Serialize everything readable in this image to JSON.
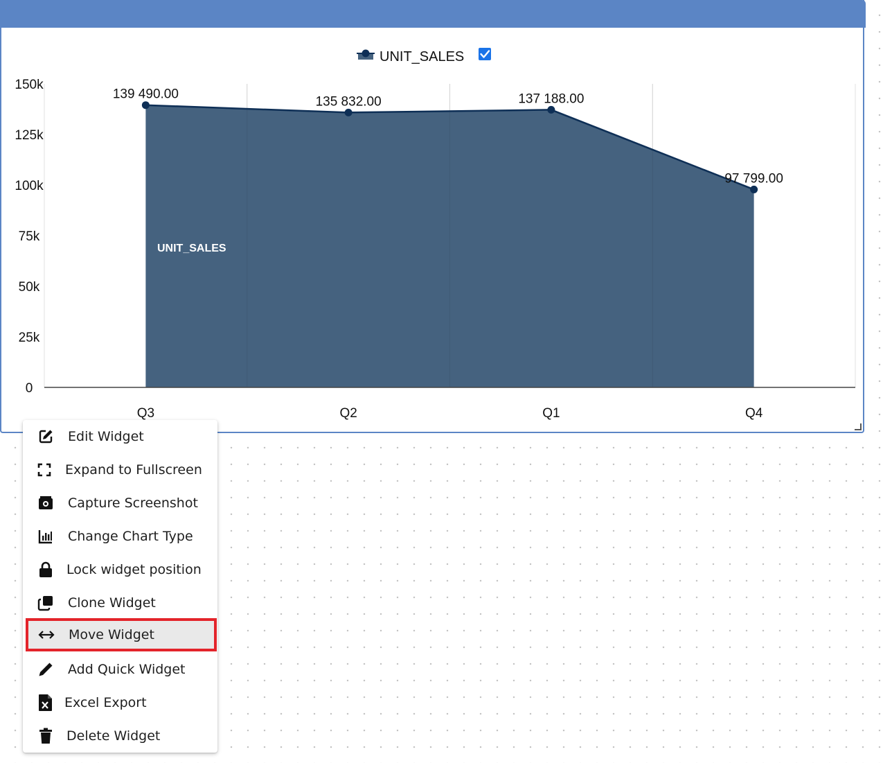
{
  "widget": {
    "legend": {
      "label": "UNIT_SALES",
      "checked": true
    },
    "inside_label": "UNIT_SALES"
  },
  "chart_data": {
    "type": "area",
    "categories": [
      "Q3",
      "Q2",
      "Q1",
      "Q4"
    ],
    "series": [
      {
        "name": "UNIT_SALES",
        "values": [
          139490,
          135832,
          137188,
          97799
        ]
      }
    ],
    "data_labels": [
      "139 490.00",
      "135 832.00",
      "137 188.00",
      "97 799.00"
    ],
    "y_ticks": [
      0,
      25000,
      50000,
      75000,
      100000,
      125000,
      150000
    ],
    "y_tick_labels": [
      "0",
      "25k",
      "50k",
      "75k",
      "100k",
      "125k",
      "150k"
    ],
    "ylim": [
      0,
      150000
    ],
    "grid": true,
    "legend_position": "top-center",
    "colors": {
      "fill": "#45627f",
      "line": "#0e2f56"
    }
  },
  "context_menu": {
    "items": [
      {
        "label": "Edit Widget",
        "icon": "edit-icon"
      },
      {
        "label": "Expand to Fullscreen",
        "icon": "fullscreen-icon"
      },
      {
        "label": "Capture Screenshot",
        "icon": "camera-icon"
      },
      {
        "label": "Change Chart Type",
        "icon": "bar-chart-icon"
      },
      {
        "label": "Lock widget position",
        "icon": "lock-icon"
      },
      {
        "label": "Clone Widget",
        "icon": "clone-icon"
      },
      {
        "label": "Move Widget",
        "icon": "move-arrows-icon",
        "selected": true
      },
      {
        "label": "Add Quick Widget",
        "icon": "pencil-icon"
      },
      {
        "label": "Excel Export",
        "icon": "excel-file-icon"
      },
      {
        "label": "Delete Widget",
        "icon": "trash-icon"
      }
    ]
  },
  "colors": {
    "header": "#5b85c5",
    "highlight_border": "#e3242b",
    "checkbox": "#1a73e8"
  }
}
